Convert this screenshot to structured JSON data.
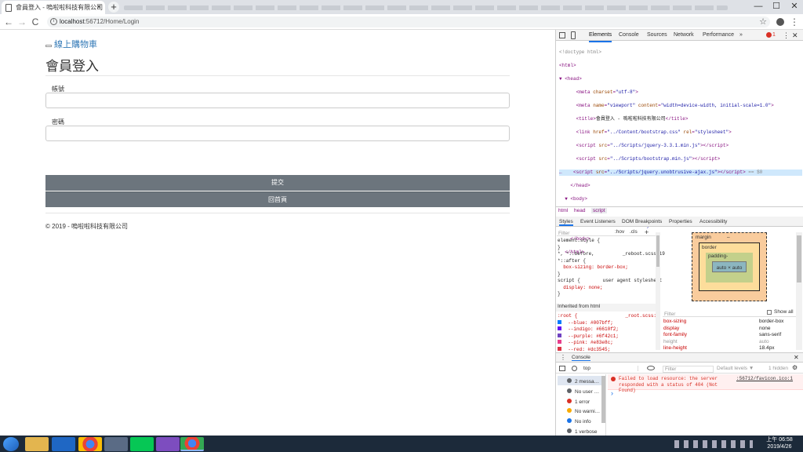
{
  "browser": {
    "tab_title": "會員登入 - 嗚啦啦科技有限公司",
    "tab_close": "×",
    "new_tab": "+",
    "address_host": "localhost",
    "address_path": ":56712/Home/Login",
    "back": "←",
    "forward": "→",
    "reload": "C",
    "star": "☆",
    "menu": "⋮",
    "win_min": "—",
    "win_max": "☐",
    "win_close": "✕"
  },
  "site": {
    "brand": "線上購物車",
    "heading": "會員登入",
    "account_label": "帳號",
    "password_label": "密碼",
    "submit_label": "提交",
    "home_label": "回首頁",
    "footer": "© 2019 - 嗚啦啦科技有限公司"
  },
  "devtools": {
    "tabs": [
      "Elements",
      "Console",
      "Sources",
      "Network",
      "Performance",
      "»"
    ],
    "error_count": "1",
    "breadcrumb": [
      "html",
      "head",
      "script"
    ],
    "style_tabs": [
      "Styles",
      "Event Listeners",
      "DOM Breakpoints",
      "Properties",
      "Accessibility"
    ],
    "filter": "Filter",
    "hov": ":hov",
    "cls": ".cls",
    "styles": [
      "element.style {",
      "}",
      "*, *::before,          _reboot.scss:19",
      "*::after {",
      "  box-sizing: border-box;",
      "}",
      "script {        user agent stylesheet",
      "  display: none;",
      "}"
    ],
    "inherited": "Inherited from  html",
    "root_rules": [
      ":root {                 _root.scss:1",
      "  --blue: #007bff;",
      "  --indigo: #6610f2;",
      "  --purple: #6f42c1;",
      "  --pink: #e83e8c;",
      "  --red: #dc3545;"
    ],
    "swatches": {
      "blue": "#007bff",
      "indigo": "#6610f2",
      "purple": "#6f42c1",
      "pink": "#e83e8c",
      "red": "#dc3545"
    },
    "boxmodel": {
      "margin": "margin",
      "border": "border",
      "padding": "padding-",
      "content": "auto × auto",
      "dash": "–"
    },
    "computed_filter": "Filter",
    "show_all": "Show all",
    "computed": [
      [
        "box-sizing",
        "border-box"
      ],
      [
        "display",
        "none"
      ],
      [
        "font-family",
        "sans-serif"
      ],
      [
        "height",
        "auto"
      ],
      [
        "line-height",
        "18.4px"
      ]
    ],
    "console_title": "Console",
    "console_context": "top",
    "console_filter": "Filter",
    "console_levels": "Default levels ▼",
    "console_hidden": "1 hidden",
    "console_sidebar": [
      "2 messa…",
      "No user …",
      "1 error",
      "No warni…",
      "No info",
      "1 verbose"
    ],
    "console_error": "Failed to load resource: the server responded with a status of 404 (Not Found)",
    "console_error_src": ":56712/favicon.ico:1",
    "prompt": "›"
  },
  "taskbar": {
    "time": "上午 06:58",
    "date": "2019/4/26"
  }
}
